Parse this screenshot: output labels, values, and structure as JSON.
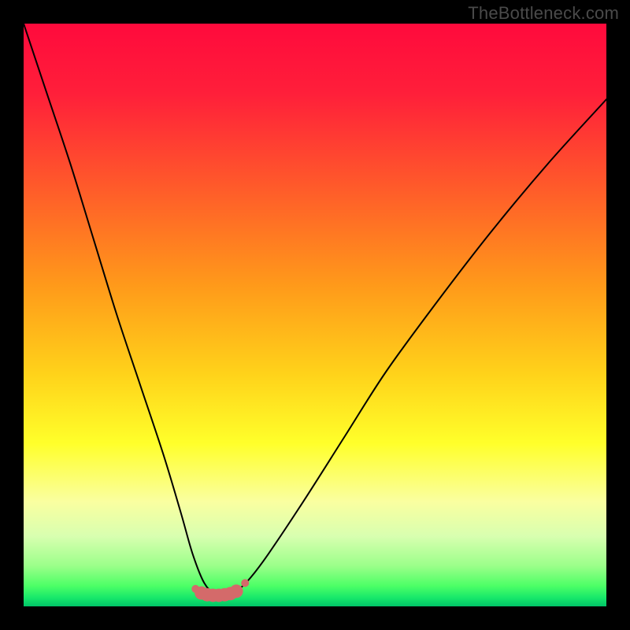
{
  "watermark": "TheBottleneck.com",
  "chart_data": {
    "type": "line",
    "title": "",
    "xlabel": "",
    "ylabel": "",
    "xlim": [
      0,
      100
    ],
    "ylim": [
      0,
      100
    ],
    "grid": false,
    "legend": false,
    "notes": "Bottleneck curve on a vertical rainbow gradient (green at bottom through yellow/orange to red at top). Minimum of the curve sits near x≈33. A short horizontal band of salmon-pink dots marks the flat bottom of the curve. Axes are unlabeled; values are visual estimates from gridless plot.",
    "series": [
      {
        "name": "bottleneck-curve",
        "x": [
          0,
          4,
          8,
          12,
          16,
          20,
          24,
          27,
          29,
          31,
          33,
          35,
          37,
          39,
          42,
          48,
          55,
          62,
          70,
          80,
          90,
          100
        ],
        "y": [
          100,
          88,
          76,
          63,
          50,
          38,
          26,
          16,
          9,
          4,
          2,
          2,
          3,
          5,
          9,
          18,
          29,
          40,
          51,
          64,
          76,
          87
        ]
      }
    ],
    "markers": {
      "name": "trough-dots",
      "color": "#d46a6a",
      "x": [
        29.5,
        30.5,
        31.5,
        32.5,
        33.5,
        34.5,
        35.5,
        36.5,
        38.0
      ],
      "y": [
        3.0,
        2.3,
        2.0,
        1.9,
        1.9,
        2.0,
        2.2,
        2.6,
        4.0
      ]
    },
    "background_gradient": {
      "direction": "vertical",
      "stops": [
        {
          "pos": 0.0,
          "color": "#ff0a3c"
        },
        {
          "pos": 0.12,
          "color": "#ff1f3a"
        },
        {
          "pos": 0.28,
          "color": "#ff5a2a"
        },
        {
          "pos": 0.45,
          "color": "#ff9a1a"
        },
        {
          "pos": 0.6,
          "color": "#ffd21a"
        },
        {
          "pos": 0.72,
          "color": "#ffff2a"
        },
        {
          "pos": 0.82,
          "color": "#faffa0"
        },
        {
          "pos": 0.88,
          "color": "#d8ffb0"
        },
        {
          "pos": 0.93,
          "color": "#9cff8a"
        },
        {
          "pos": 0.965,
          "color": "#4cff66"
        },
        {
          "pos": 0.985,
          "color": "#18e86a"
        },
        {
          "pos": 1.0,
          "color": "#00c468"
        }
      ]
    }
  }
}
